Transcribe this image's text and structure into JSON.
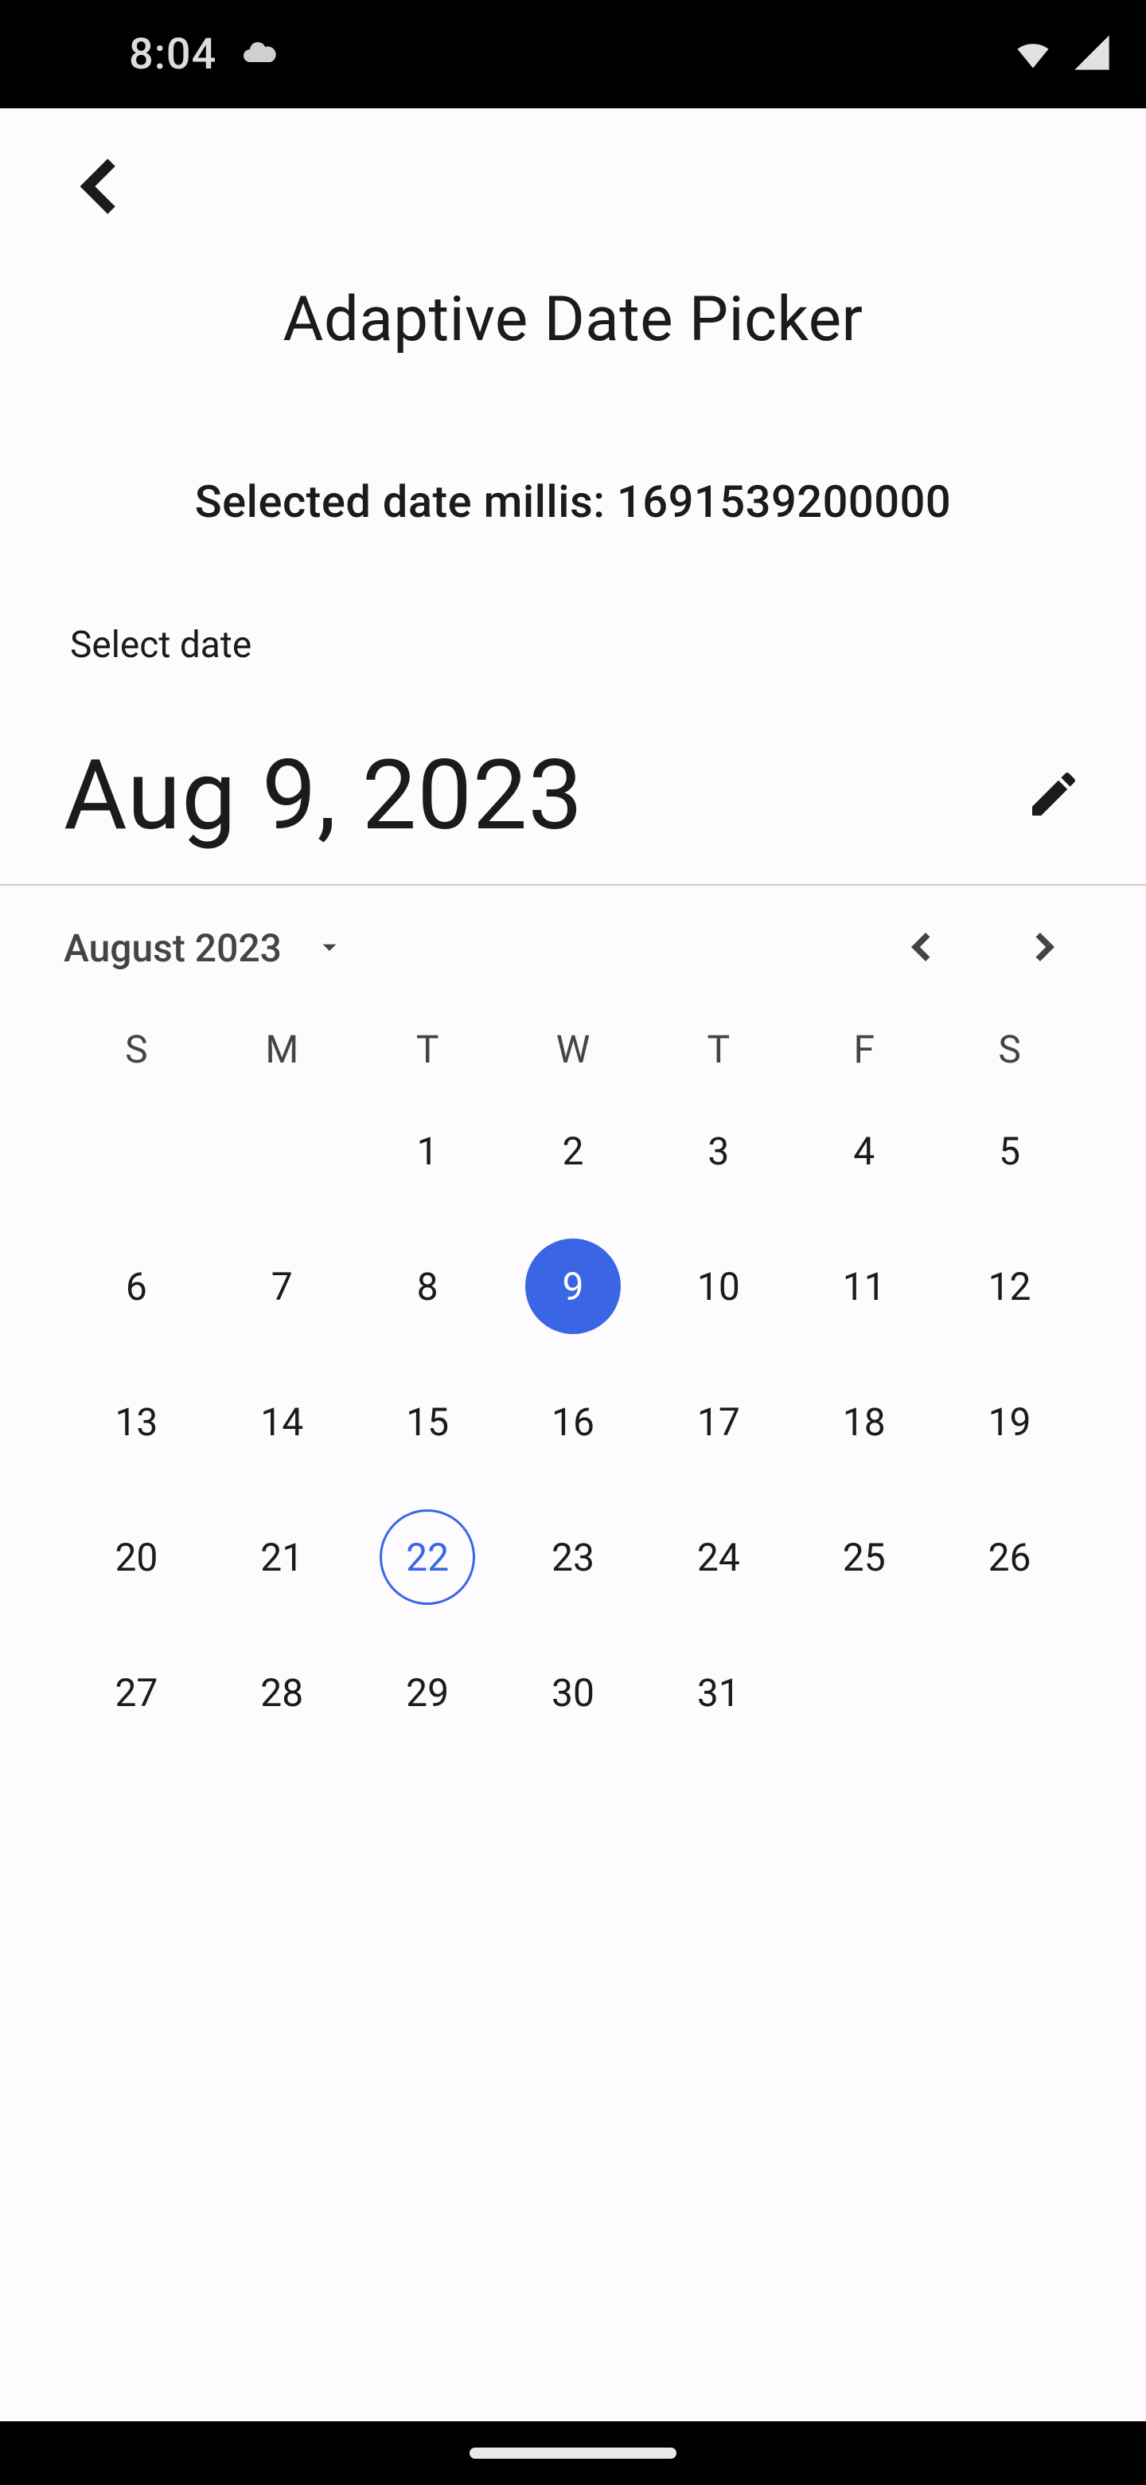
{
  "status": {
    "time": "8:04"
  },
  "header": {
    "title": "Adaptive Date Picker",
    "subline_prefix": "Selected date millis: ",
    "millis": "1691539200000"
  },
  "picker": {
    "select_label": "Select date",
    "headline": "Aug 9, 2023",
    "month_label": "August 2023",
    "dow": [
      "S",
      "M",
      "T",
      "W",
      "T",
      "F",
      "S"
    ],
    "selected_day": 9,
    "today": 22,
    "first_dow": 2,
    "days_in_month": 31
  }
}
